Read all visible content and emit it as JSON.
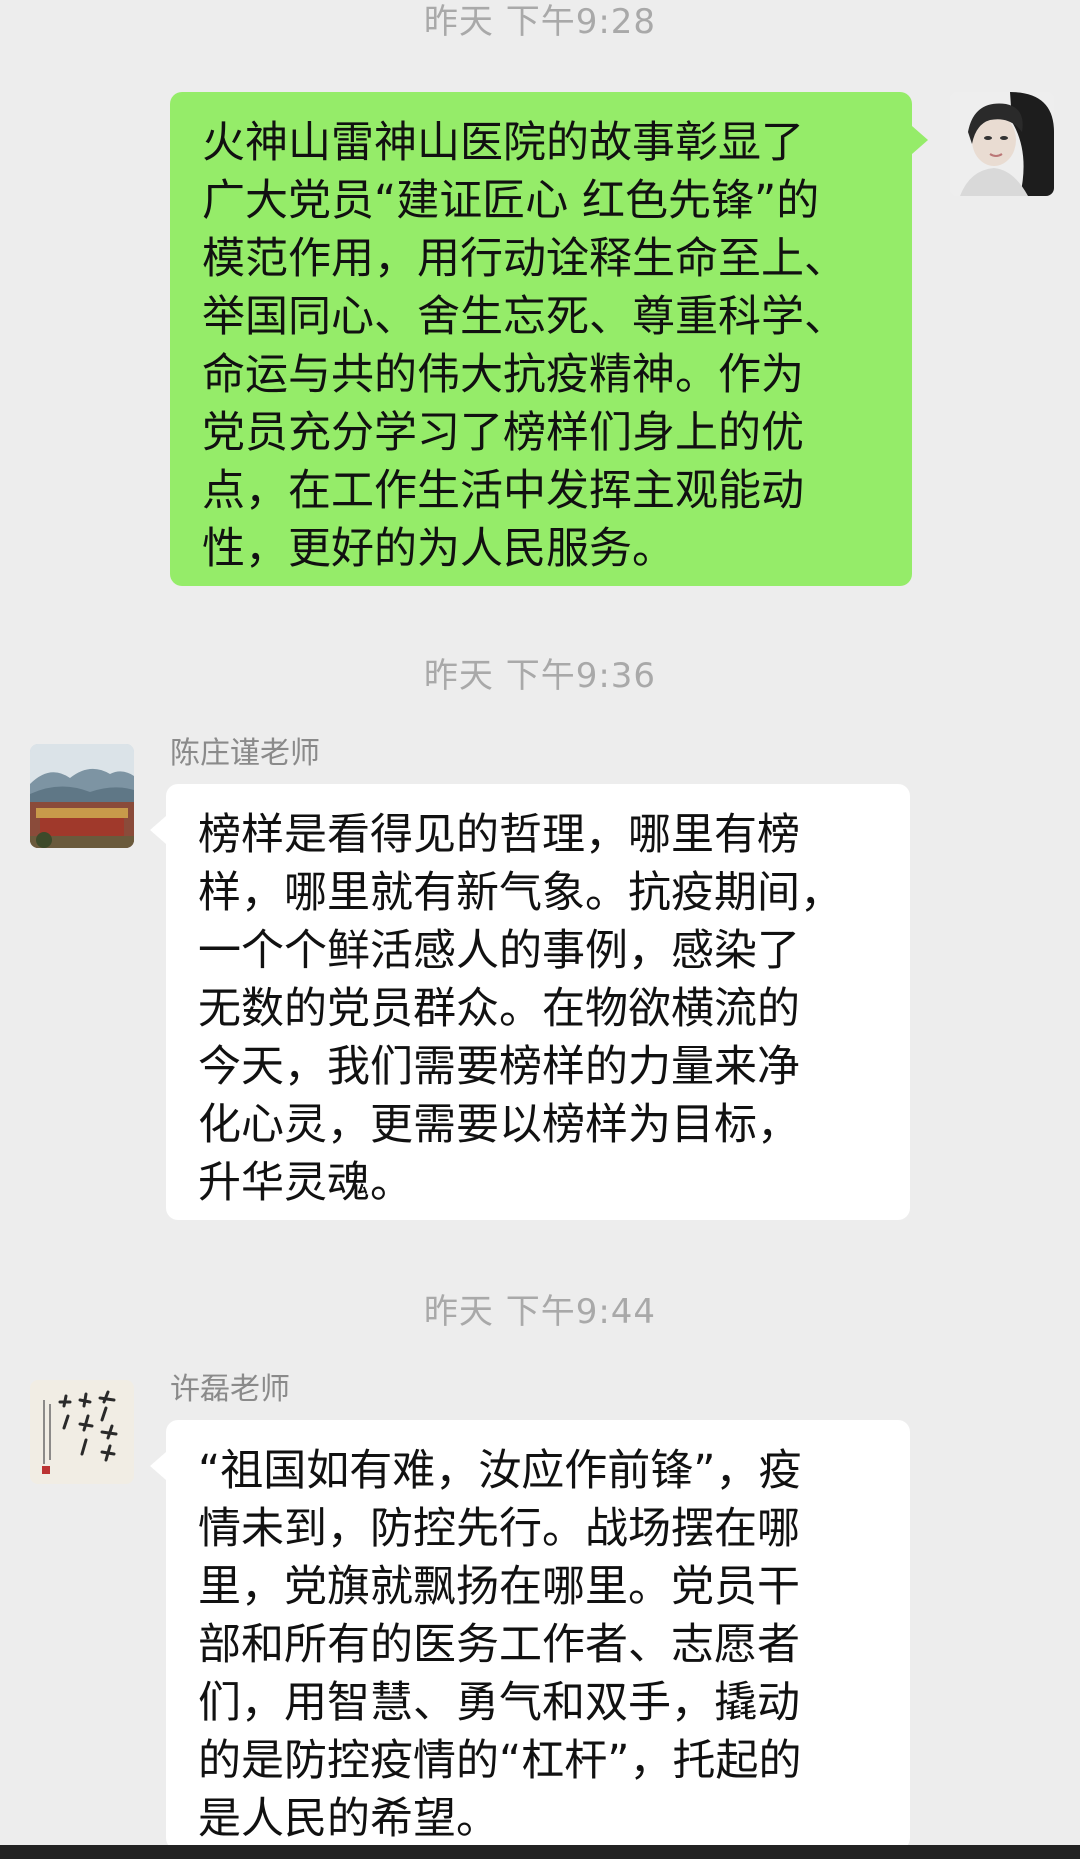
{
  "messages": [
    {
      "time": "昨天 下午9:28",
      "direction": "outgoing",
      "avatar": "self-avatar-photo",
      "text": "火神山雷神山医院的故事彰显了\n广大党员“建证匠心 红色先锋”的\n模范作用，用行动诠释生命至上、\n举国同心、舍生忘死、尊重科学、\n命运与共的伟大抗疫精神。作为\n党员充分学习了榜样们身上的优\n点，在工作生活中发挥主观能动\n性，更好的为人民服务。"
    },
    {
      "time": "昨天 下午9:36",
      "direction": "incoming",
      "sender": "陈庄谨老师",
      "avatar": "palace-landscape-avatar",
      "text": "榜样是看得见的哲理，哪里有榜\n样，哪里就有新气象。抗疫期间，\n一个个鲜活感人的事例，感染了\n无数的党员群众。在物欲横流的\n今天，我们需要榜样的力量来净\n化心灵，更需要以榜样为目标，\n升华灵魂。"
    },
    {
      "time": "昨天 下午9:44",
      "direction": "incoming",
      "sender": "许磊老师",
      "avatar": "calligraphy-avatar",
      "text": "“祖国如有难，汝应作前锋”，疫\n情未到，防控先行。战场摆在哪\n里，党旗就飘扬在哪里。党员干\n部和所有的医务工作者、志愿者\n们，用智慧、勇气和双手，撬动\n的是防控疫情的“杠杆”，托起的\n是人民的希望。"
    }
  ],
  "colors": {
    "background": "#ededed",
    "outgoing_bubble": "#95ec69",
    "incoming_bubble": "#ffffff",
    "timestamp": "#a9a9a9",
    "sender_name": "#8a8a8a"
  }
}
